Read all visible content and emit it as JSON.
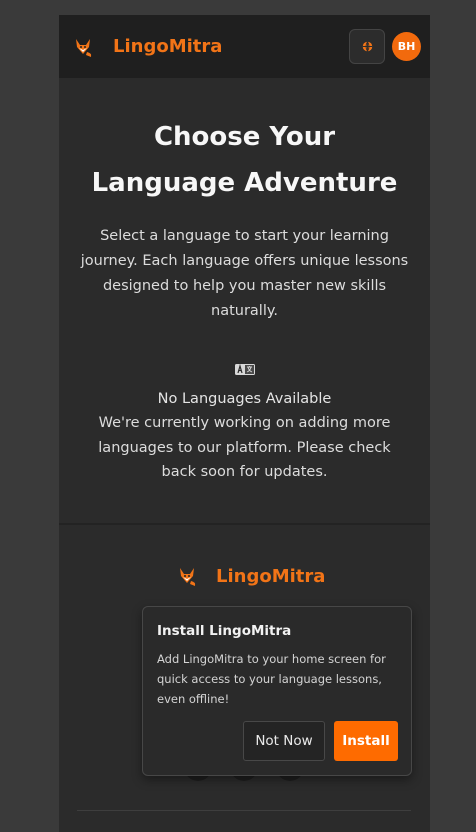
{
  "header": {
    "brand": "LingoMitra",
    "avatar_initials": "BH",
    "language_icon": "globe-icon"
  },
  "hero": {
    "title": "Choose Your Language Adventure",
    "description": "Select a language to start your learning journey. Each language offers unique lessons designed to help you master new skills naturally."
  },
  "empty_state": {
    "icon": "translate-icon",
    "title": "No Languages Available",
    "text": "We're currently working on adding more languages to our platform. Please check back soon for updates."
  },
  "footer": {
    "brand": "LingoMitra"
  },
  "install_prompt": {
    "title": "Install LingoMitra",
    "text": "Add LingoMitra to your home screen for quick access to your language lessons, even offline!",
    "dismiss_label": "Not Now",
    "install_label": "Install"
  },
  "colors": {
    "accent": "#f27417",
    "install_button": "#fe6b00",
    "background": "#2b2b2b",
    "header": "#1f1f1f"
  }
}
